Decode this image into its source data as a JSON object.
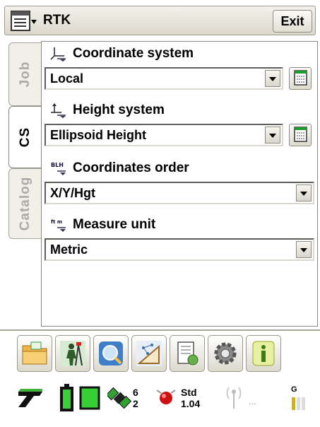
{
  "window": {
    "title": "RTK",
    "exit_label": "Exit"
  },
  "tabs": [
    {
      "label": "Job",
      "active": false
    },
    {
      "label": "CS",
      "active": true
    },
    {
      "label": "Catalog",
      "active": false
    }
  ],
  "fields": {
    "coordinate_system": {
      "label": "Coordinate system",
      "value": "Local"
    },
    "height_system": {
      "label": "Height system",
      "value": "Ellipsoid Height"
    },
    "coordinates_order": {
      "label": "Coordinates order",
      "value": "X/Y/Hgt",
      "icon_text": "BLH"
    },
    "measure_unit": {
      "label": "Measure unit",
      "value": "Metric",
      "icon_text": "ft m"
    }
  },
  "toolbar": {
    "buttons": [
      "folder-icon",
      "surveyor-icon",
      "view-icon",
      "cogo-icon",
      "import-export-icon",
      "settings-gear-icon",
      "info-icon"
    ]
  },
  "status": {
    "sat_top": "6",
    "sat_bottom": "2",
    "solution_label": "Std",
    "solution_value": "1.04",
    "radio_text": "...",
    "gsm_label": "G"
  },
  "colors": {
    "accent_green": "#1fae1f",
    "status_red": "#d01010",
    "tab_inactive_text": "#aaaaaa"
  }
}
